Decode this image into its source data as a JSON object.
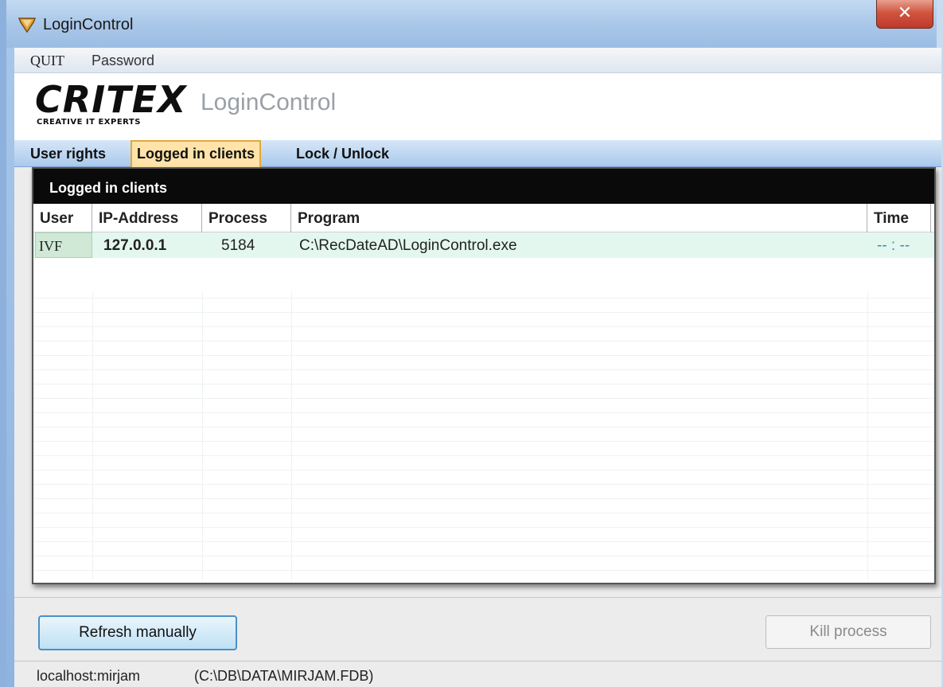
{
  "window": {
    "title": "LoginControl",
    "close_glyph": "✕"
  },
  "menu": {
    "items": [
      "QUIT",
      "Password"
    ]
  },
  "header": {
    "logo_text": "CRITEX",
    "logo_tagline": "CREATIVE IT EXPERTS",
    "app_title": "LoginControl"
  },
  "tabs": [
    {
      "label": "User rights",
      "selected": false
    },
    {
      "label": "Logged in clients",
      "selected": true
    },
    {
      "label": "Lock / Unlock",
      "selected": false
    }
  ],
  "panel": {
    "title": "Logged in clients",
    "columns": [
      "User",
      "IP-Address",
      "Process",
      "Program",
      "Time"
    ],
    "rows": [
      {
        "user": "IVF",
        "ip": "127.0.0.1",
        "process": "5184",
        "program": "C:\\RecDateAD\\LoginControl.exe",
        "time": "-- : --"
      }
    ]
  },
  "buttons": {
    "refresh": "Refresh manually",
    "kill": "Kill process"
  },
  "status": {
    "host": "localhost:mirjam",
    "database": "(C:\\DB\\DATA\\MIRJAM.FDB)"
  },
  "colors": {
    "selected_tab": "#ffe3a8",
    "row_highlight": "#e3f7ef",
    "panel_header": "#0a0a0a",
    "title_bar": "#a8c6e8"
  },
  "icons": {
    "app": "app-shield-icon",
    "close": "close-icon"
  }
}
